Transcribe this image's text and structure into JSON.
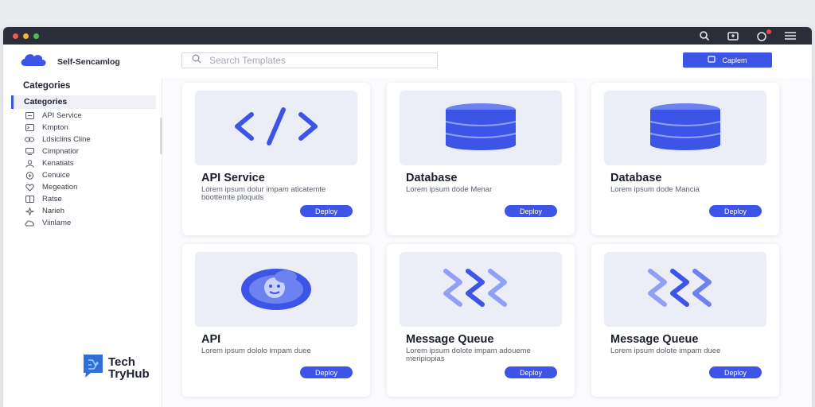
{
  "window": {
    "toolbar_icons": [
      "search-icon",
      "inbox-icon",
      "notification-icon",
      "menu-icon"
    ]
  },
  "header": {
    "app_name": "Self-Sencamlog",
    "search": {
      "placeholder": "Search Templates"
    },
    "button_label": "Caplem"
  },
  "sidebar": {
    "title": "Categories",
    "active_item": "Categories",
    "items": [
      {
        "label": "API Service",
        "icon": "api-icon"
      },
      {
        "label": "Kmpton",
        "icon": "terminal-icon"
      },
      {
        "label": "Ldsiclins Cline",
        "icon": "link-icon"
      },
      {
        "label": "Cimpnatior",
        "icon": "monitor-icon"
      },
      {
        "label": "Kenatiats",
        "icon": "user-icon"
      },
      {
        "label": "Cenuice",
        "icon": "plus-circle-icon"
      },
      {
        "label": "Megeation",
        "icon": "heart-icon"
      },
      {
        "label": "Ratse",
        "icon": "grid-icon"
      },
      {
        "label": "Narieh",
        "icon": "sparkle-icon"
      },
      {
        "label": "Viinlame",
        "icon": "cloud-icon"
      }
    ]
  },
  "brand": {
    "line1": "Tech",
    "line2": "TryHub"
  },
  "cards": [
    {
      "title": "API Service",
      "desc": "Lorem ipsum dolur impam aticatemte boottemte ploquds",
      "button": "Deploy",
      "icon": "code-icon"
    },
    {
      "title": "Database",
      "desc": "Lorem ipsum dode Menar",
      "button": "Deploy",
      "icon": "database-icon"
    },
    {
      "title": "Database",
      "desc": "Lorem ipsum dode Mancia",
      "button": "Deploy",
      "icon": "database-icon"
    },
    {
      "title": "API",
      "desc": "Lorem ipsum dololo impam duee",
      "button": "Deploy",
      "icon": "cloud-face-icon"
    },
    {
      "title": "Message Queue",
      "desc": "Lorem ipsum dolote impam adoueme meripiopias",
      "button": "Deploy",
      "icon": "wave-icon"
    },
    {
      "title": "Message Queue",
      "desc": "Lorem ipsum dolote impam duee",
      "button": "Deploy",
      "icon": "wave-icon"
    }
  ],
  "colors": {
    "accent": "#3c55e6",
    "titlebar": "#2b2e38",
    "card_image_bg": "#eceef7"
  }
}
